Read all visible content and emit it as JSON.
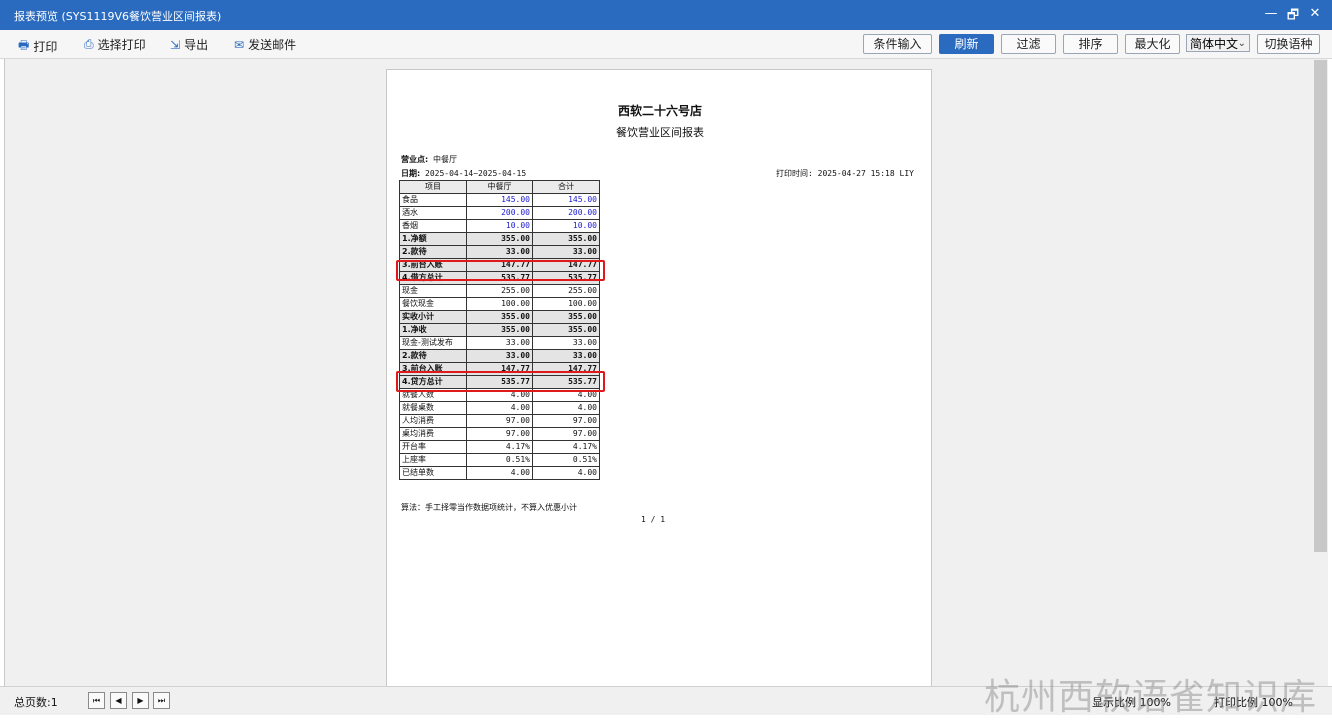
{
  "window": {
    "title": "报表预览 (SYS1119V6餐饮营业区间报表)",
    "minimize": "—",
    "restore": "🗗",
    "close": "✕"
  },
  "toolbar": {
    "print": "打印",
    "select_print": "选择打印",
    "export": "导出",
    "send_email": "发送邮件",
    "condition_input": "条件输入",
    "refresh": "刷新",
    "filter": "过滤",
    "sort": "排序",
    "maximize": "最大化",
    "language": "简体中文",
    "switch_language": "切换语种"
  },
  "report": {
    "store_name": "西软二十六号店",
    "title": "餐饮营业区间报表",
    "outlet_label": "营业点:",
    "outlet_value": "中餐厅",
    "date_label": "日期:",
    "date_value": "2025-04-14~2025-04-15",
    "print_time": "打印时间: 2025-04-27 15:18 LIY",
    "headers": [
      "项目",
      "中餐厅",
      "合计"
    ],
    "rows": [
      {
        "item": "食品",
        "v1": "145.00",
        "v2": "145.00",
        "style": "blue"
      },
      {
        "item": "酒水",
        "v1": "200.00",
        "v2": "200.00",
        "style": "blue"
      },
      {
        "item": "香烟",
        "v1": "10.00",
        "v2": "10.00",
        "style": "blue"
      },
      {
        "item": "1.净额",
        "v1": "355.00",
        "v2": "355.00",
        "style": "bold"
      },
      {
        "item": "2.款待",
        "v1": "33.00",
        "v2": "33.00",
        "style": "bold"
      },
      {
        "item": "3.前台入账",
        "v1": "147.77",
        "v2": "147.77",
        "style": "bold"
      },
      {
        "item": "4.借方总计",
        "v1": "535.77",
        "v2": "535.77",
        "style": "bold"
      },
      {
        "item": "现金",
        "v1": "255.00",
        "v2": "255.00",
        "style": "normal"
      },
      {
        "item": "餐饮现金",
        "v1": "100.00",
        "v2": "100.00",
        "style": "normal"
      },
      {
        "item": "实收小计",
        "v1": "355.00",
        "v2": "355.00",
        "style": "bold"
      },
      {
        "item": "1.净收",
        "v1": "355.00",
        "v2": "355.00",
        "style": "bold"
      },
      {
        "item": "现金-测试发布",
        "v1": "33.00",
        "v2": "33.00",
        "style": "normal"
      },
      {
        "item": "2.款待",
        "v1": "33.00",
        "v2": "33.00",
        "style": "bold"
      },
      {
        "item": "3.前台入账",
        "v1": "147.77",
        "v2": "147.77",
        "style": "bold"
      },
      {
        "item": "4.贷方总计",
        "v1": "535.77",
        "v2": "535.77",
        "style": "bold"
      },
      {
        "item": "就餐人数",
        "v1": "4.00",
        "v2": "4.00",
        "style": "normal"
      },
      {
        "item": "就餐桌数",
        "v1": "4.00",
        "v2": "4.00",
        "style": "normal"
      },
      {
        "item": "人均消费",
        "v1": "97.00",
        "v2": "97.00",
        "style": "normal"
      },
      {
        "item": "桌均消费",
        "v1": "97.00",
        "v2": "97.00",
        "style": "normal"
      },
      {
        "item": "开台率",
        "v1": "4.17%",
        "v2": "4.17%",
        "style": "normal"
      },
      {
        "item": "上座率",
        "v1": "0.51%",
        "v2": "0.51%",
        "style": "normal"
      },
      {
        "item": "已结单数",
        "v1": "4.00",
        "v2": "4.00",
        "style": "normal"
      }
    ],
    "note": "算法：手工择零当作数据项统计，不算入优惠小计",
    "page_indicator": "1 / 1"
  },
  "status": {
    "total_pages": "总页数:1",
    "nav_first": "⏮",
    "nav_prev": "◀",
    "nav_next": "▶",
    "nav_last": "⏭",
    "display_ratio": "显示比例 100%",
    "print_ratio": "打印比例 100%"
  },
  "watermark": "杭州西软语雀知识库"
}
